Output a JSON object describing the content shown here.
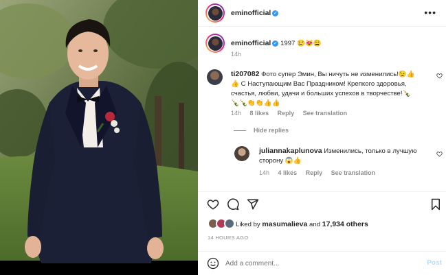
{
  "post": {
    "username": "eminofficial",
    "caption_user": "eminofficial",
    "caption_text": "1997 😢😻😩",
    "caption_time": "14h"
  },
  "comments": [
    {
      "user": "ti207082",
      "text": "Фото супер Эмин, Вы ничуть не изменились!😉👍👍 С Наступающим Вас Праздником! Крепкого здоровья, счастья, любви, удачи и больших успехов в творчестве!🍾🍾🍾👏👏👍👍",
      "line1": "Фото супер Эмин, Вы ничуть не изменились!😉👍",
      "line2": "👍 С Наступающим Вас Праздником! Крепкого здоровья,",
      "line3": "счастья, любви, удачи и больших успехов в творчестве!🍾",
      "line4": "🍾🍾👏👏👍👍",
      "time": "14h",
      "likes": "8 likes",
      "reply": "Reply",
      "translate": "See translation"
    }
  ],
  "hide_replies": "Hide replies",
  "reply": {
    "user": "juliannakaplunova",
    "line1": "Изменились, только в лучшую",
    "line2": "сторону 😱👍",
    "time": "14h",
    "likes": "4 likes",
    "reply": "Reply",
    "translate": "See translation"
  },
  "likes": {
    "prefix": "Liked by",
    "user": "masumalieva",
    "and": "and",
    "count": "17,934 others"
  },
  "timestamp": "14 HOURS AGO",
  "add_comment": {
    "placeholder": "Add a comment...",
    "post_label": "Post"
  },
  "colors": {
    "link_blue": "#0095f6",
    "verified_blue": "#3897f0",
    "muted": "#8e8e8e"
  },
  "icons": [
    "more-icon",
    "verified-icon",
    "heart-icon",
    "comment-icon",
    "share-icon",
    "save-icon",
    "emoji-icon"
  ]
}
